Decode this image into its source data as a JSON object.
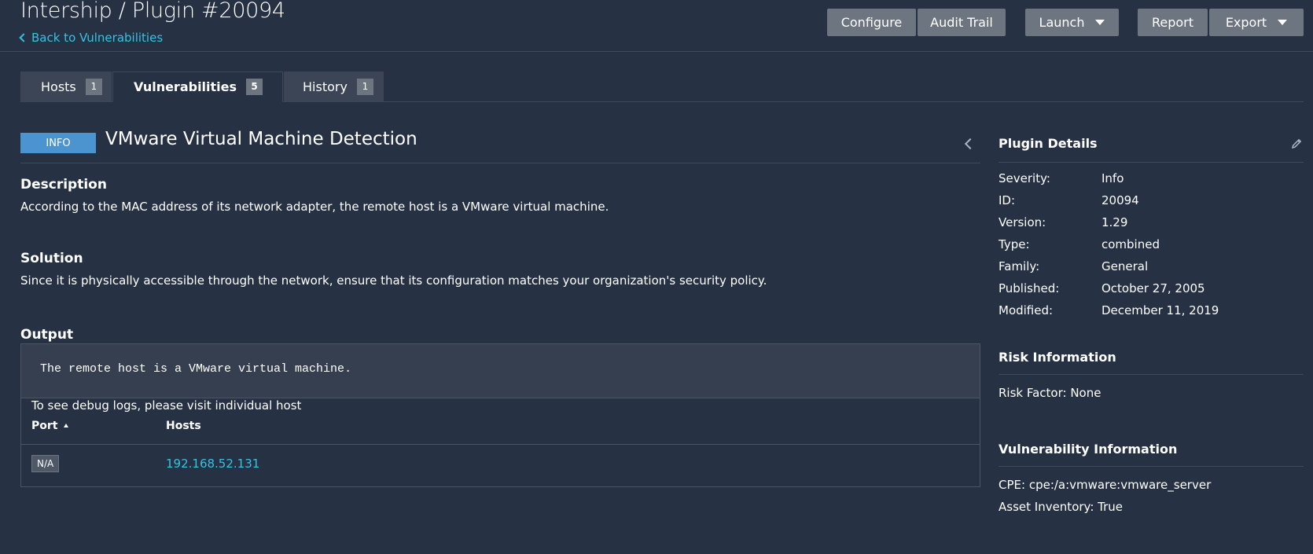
{
  "header": {
    "title": "Intership / Plugin #20094",
    "back_label": "Back to Vulnerabilities",
    "buttons": {
      "configure": "Configure",
      "audit_trail": "Audit Trail",
      "launch": "Launch",
      "report": "Report",
      "export": "Export"
    }
  },
  "tabs": [
    {
      "label": "Hosts",
      "count": "1"
    },
    {
      "label": "Vulnerabilities",
      "count": "5"
    },
    {
      "label": "History",
      "count": "1"
    }
  ],
  "vulnerability": {
    "severity": "INFO",
    "title": "VMware Virtual Machine Detection",
    "description_heading": "Description",
    "description": "According to the MAC address of its network adapter, the remote host is a VMware virtual machine.",
    "solution_heading": "Solution",
    "solution": "Since it is physically accessible through the network, ensure that its configuration matches your organization's security policy.",
    "output_heading": "Output",
    "output": "The remote host is a VMware virtual machine.",
    "debug_note": "To see debug logs, please visit individual host",
    "columns": {
      "port": "Port",
      "hosts": "Hosts"
    },
    "rows": [
      {
        "port": "N/A",
        "host": "192.168.52.131"
      }
    ]
  },
  "plugin_details": {
    "heading": "Plugin Details",
    "fields": [
      {
        "label": "Severity:",
        "value": "Info"
      },
      {
        "label": "ID:",
        "value": "20094"
      },
      {
        "label": "Version:",
        "value": "1.29"
      },
      {
        "label": "Type:",
        "value": "combined"
      },
      {
        "label": "Family:",
        "value": "General"
      },
      {
        "label": "Published:",
        "value": "October 27, 2005"
      },
      {
        "label": "Modified:",
        "value": "December 11, 2019"
      }
    ]
  },
  "risk_information": {
    "heading": "Risk Information",
    "risk_factor": "Risk Factor: None"
  },
  "vulnerability_information": {
    "heading": "Vulnerability Information",
    "cpe": "CPE: cpe:/a:vmware:vmware_server",
    "asset_inventory": "Asset Inventory: True"
  },
  "colors": {
    "background": "#263244",
    "accent_link": "#36c2e2",
    "info_badge": "#4b94d0",
    "button": "#6d7580"
  }
}
